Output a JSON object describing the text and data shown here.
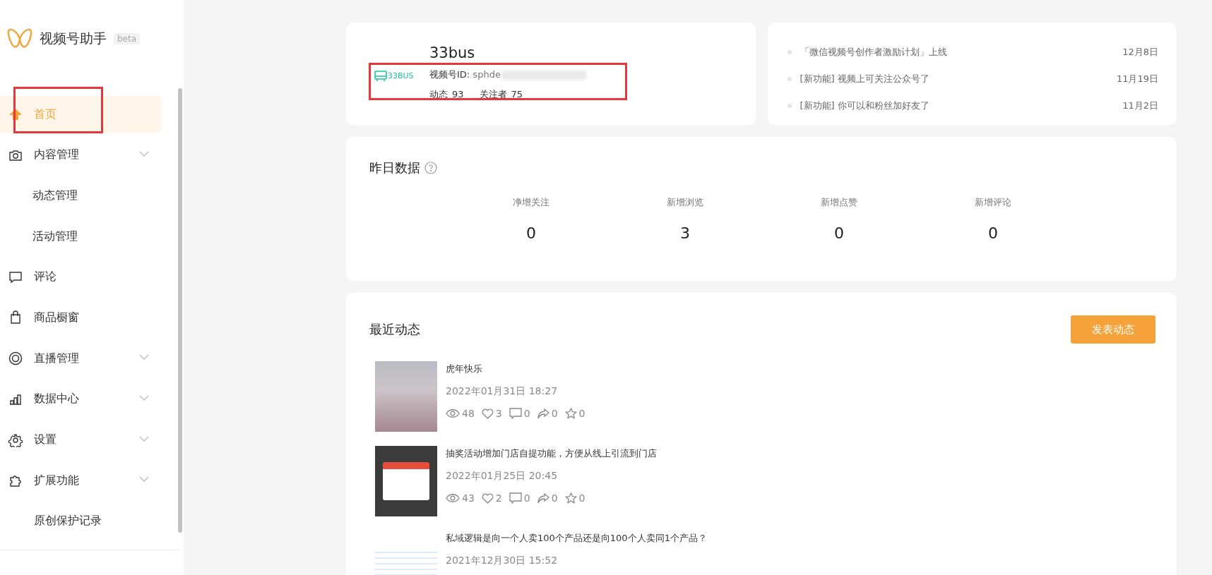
{
  "sidebar": {
    "app_name": "视频号助手",
    "badge": "beta",
    "items": [
      {
        "label": "首页",
        "kind": "link",
        "selected": true
      },
      {
        "label": "内容管理",
        "kind": "group",
        "selected": false,
        "children": [
          {
            "label": "动态管理",
            "selected": false
          },
          {
            "label": "活动管理",
            "selected": false
          }
        ]
      },
      {
        "label": "评论",
        "kind": "link",
        "selected": false
      },
      {
        "label": "商品橱窗",
        "kind": "link",
        "selected": false
      },
      {
        "label": "直播管理",
        "kind": "group",
        "selected": false
      },
      {
        "label": "数据中心",
        "kind": "group",
        "selected": false
      },
      {
        "label": "设置",
        "kind": "group",
        "selected": false
      },
      {
        "label": "扩展功能",
        "kind": "group",
        "selected": false
      },
      {
        "label": "原创保护记录",
        "kind": "link",
        "selected": false
      }
    ]
  },
  "profile": {
    "logo_text": "33BUS",
    "name": "33bus",
    "id_label": "视频号ID:",
    "id_value": "sphde",
    "posts_label": "动态",
    "posts": "93",
    "followers_label": "关注者",
    "followers": "75"
  },
  "news": [
    {
      "title": "「微信视频号创作者激励计划」上线",
      "date": "12月8日"
    },
    {
      "title": "[新功能] 视频上可关注公众号了",
      "date": "11月19日"
    },
    {
      "title": "[新功能] 你可以和粉丝加好友了",
      "date": "11月2日"
    }
  ],
  "stats": {
    "title": "昨日数据",
    "items": [
      {
        "label": "净增关注",
        "value": "0"
      },
      {
        "label": "新增浏览",
        "value": "3"
      },
      {
        "label": "新增点赞",
        "value": "0"
      },
      {
        "label": "新增评论",
        "value": "0"
      }
    ]
  },
  "recent": {
    "title": "最近动态",
    "button": "发表动态",
    "posts": [
      {
        "title": "虎年快乐",
        "time": "2022年01月31日 18:27",
        "metrics": [
          {
            "kind": "views",
            "value": "48"
          },
          {
            "kind": "likes",
            "value": "3"
          },
          {
            "kind": "comments",
            "value": "0"
          },
          {
            "kind": "shares",
            "value": "0"
          },
          {
            "kind": "favorites",
            "value": "0"
          }
        ]
      },
      {
        "title": "抽奖活动增加门店自提功能，方便从线上引流到门店",
        "time": "2022年01月25日 20:45",
        "metrics": [
          {
            "kind": "views",
            "value": "43"
          },
          {
            "kind": "likes",
            "value": "2"
          },
          {
            "kind": "comments",
            "value": "0"
          },
          {
            "kind": "shares",
            "value": "0"
          },
          {
            "kind": "favorites",
            "value": "0"
          }
        ]
      },
      {
        "title": "私域逻辑是向一个人卖100个产品还是向100个人卖同1个产品？",
        "time": "2021年12月30日 15:52"
      }
    ]
  }
}
